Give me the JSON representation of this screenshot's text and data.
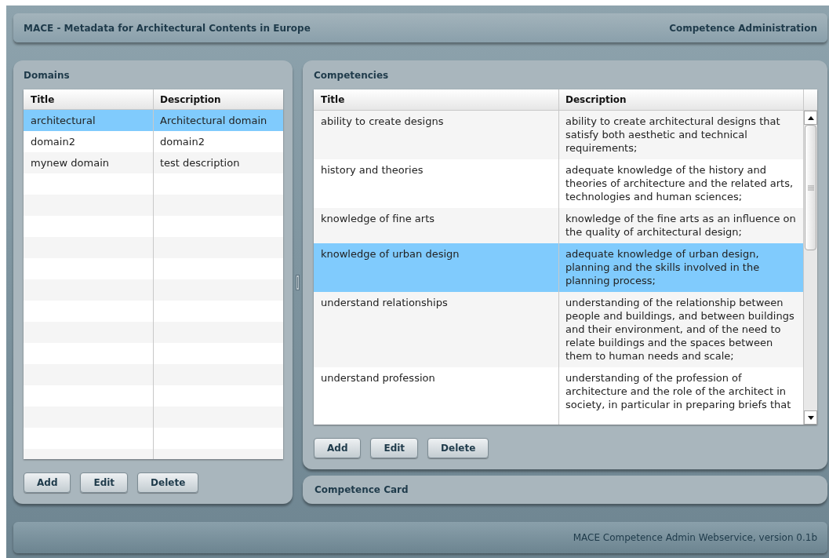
{
  "header": {
    "title": "MACE - Metadata for Architectural Contents in Europe",
    "section": "Competence Administration"
  },
  "domains": {
    "title": "Domains",
    "columns": [
      "Title",
      "Description"
    ],
    "rows": [
      {
        "title": "architectural",
        "description": "Architectural domain",
        "selected": true
      },
      {
        "title": "domain2",
        "description": "domain2",
        "selected": false
      },
      {
        "title": "mynew domain",
        "description": "test description",
        "selected": false
      }
    ],
    "buttons": [
      "Add",
      "Edit",
      "Delete"
    ]
  },
  "competencies": {
    "title": "Competencies",
    "columns": [
      "Title",
      "Description"
    ],
    "rows": [
      {
        "title": "ability to create designs",
        "description": "ability to create architectural designs that satisfy both aesthetic and technical requirements;",
        "selected": false
      },
      {
        "title": "history and theories",
        "description": "adequate knowledge of the history and theories of architecture and the related arts, technologies and human sciences;",
        "selected": false
      },
      {
        "title": "knowledge of fine arts",
        "description": "knowledge of the fine arts as an influence on the quality of architectural design;",
        "selected": false
      },
      {
        "title": "knowledge of urban design",
        "description": "adequate knowledge of urban design, planning and the skills involved in the planning process;",
        "selected": true
      },
      {
        "title": "understand relationships",
        "description": "understanding of the relationship between people and buildings, and between buildings and their environment, and of the need to relate buildings and the spaces between them to human needs and scale;",
        "selected": false
      },
      {
        "title": "understand profession",
        "description": "understanding of the profession of architecture and the role of the architect in society, in particular in preparing briefs that",
        "selected": false
      }
    ],
    "buttons": [
      "Add",
      "Edit",
      "Delete"
    ]
  },
  "competence_card": {
    "title": "Competence Card"
  },
  "status_bar": "MACE Competence Admin Webservice, version 0.1b"
}
